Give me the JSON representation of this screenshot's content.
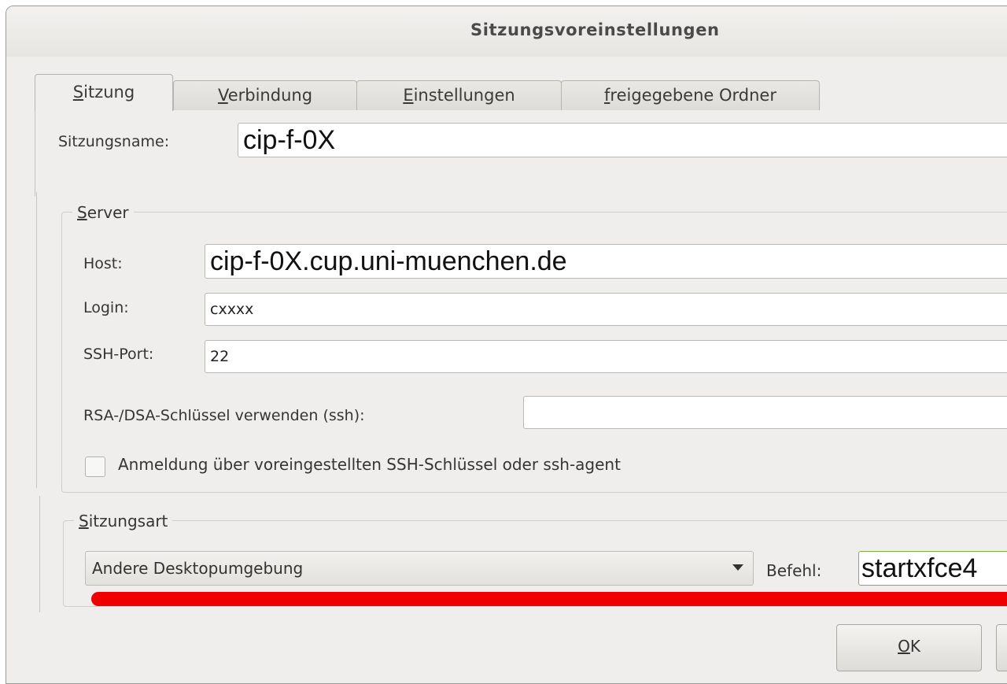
{
  "window": {
    "title": "Sitzungsvoreinstellungen"
  },
  "tabs": [
    {
      "u": "S",
      "rest": "itzung",
      "active": true
    },
    {
      "u": "V",
      "rest": "erbindung",
      "active": false
    },
    {
      "u": "E",
      "rest": "instellungen",
      "active": false
    },
    {
      "u": "f",
      "rest": "reigegebene Ordner",
      "active": false
    }
  ],
  "session": {
    "label": "Sitzungsname:",
    "value": "cip-f-0X"
  },
  "server": {
    "group_u": "S",
    "group_rest": "erver",
    "host_label": "Host:",
    "host_value": "cip-f-0X.cup.uni-muenchen.de",
    "login_label": "Login:",
    "login_value": "cxxxx",
    "port_label": "SSH-Port:",
    "port_value": "22",
    "rsa_label": "RSA-/DSA-Schlüssel verwenden (ssh):",
    "rsa_value": "",
    "agent_checkbox_label": "Anmeldung über voreingestellten SSH-Schlüssel oder ssh-agent",
    "agent_checked": false
  },
  "session_type": {
    "group_u": "S",
    "group_rest": "itzungsart",
    "selected": "Andere Desktopumgebung",
    "command_label": "Befehl:",
    "command_value": "startxfce4"
  },
  "buttons": {
    "ok_u": "O",
    "ok_rest": "K"
  },
  "colors": {
    "highlight": "#f00000",
    "command_border": "#7fb34a"
  }
}
